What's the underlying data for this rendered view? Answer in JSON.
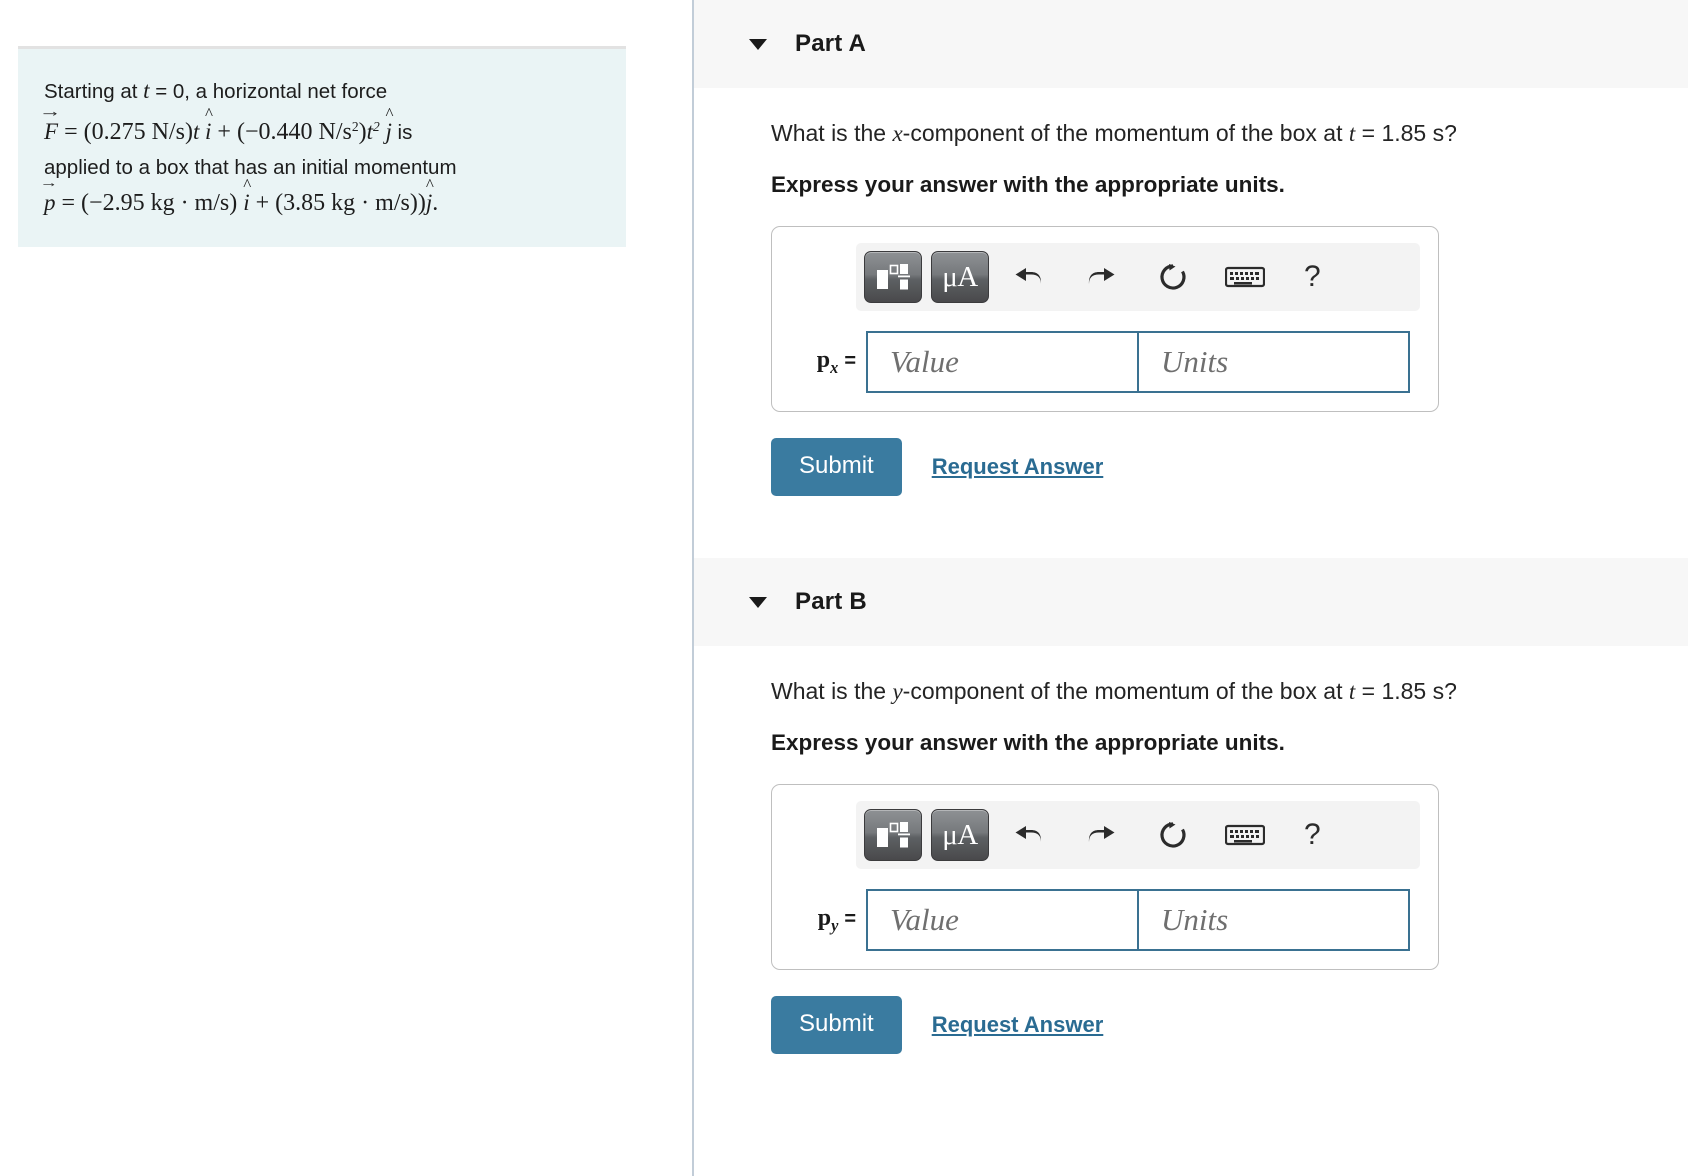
{
  "problem": {
    "line1_pre": "Starting at ",
    "line1_var": "t",
    "line1_post": " = 0, a horizontal net force",
    "force_symbol": "F",
    "force_coeff1": "0.275 N/s",
    "force_coeff2": "−0.440 N/s",
    "force_tail": "is",
    "line3": "applied to a box that has an initial momentum",
    "momentum_symbol": "p",
    "momentum_x": "−2.95 kg · m/s",
    "momentum_y": "3.85 kg · m/s"
  },
  "parts": [
    {
      "id": "a",
      "title": "Part A",
      "caret": "caret-down-icon",
      "question_pre": "What is the ",
      "question_var": "x",
      "question_mid": "-component of the momentum of the box at ",
      "question_time_var": "t",
      "question_post": " = 1.85 s?",
      "express": "Express your answer with the appropriate units.",
      "toolbar": {
        "template_button": "math-template-icon",
        "units_button": "μA",
        "units_button_name": "greek-units-icon",
        "undo": "undo-icon",
        "redo": "redo-icon",
        "reset": "reset-icon",
        "keyboard": "keyboard-icon",
        "help": "?"
      },
      "field_label_base": "p",
      "field_label_sub": "x",
      "field_label_eq": "=",
      "value_placeholder": "Value",
      "units_placeholder": "Units",
      "value_text": "",
      "units_text": "",
      "submit_label": "Submit",
      "request_label": "Request Answer"
    },
    {
      "id": "b",
      "title": "Part B",
      "caret": "caret-down-icon",
      "question_pre": "What is the ",
      "question_var": "y",
      "question_mid": "-component of the momentum of the box at ",
      "question_time_var": "t",
      "question_post": " = 1.85 s?",
      "express": "Express your answer with the appropriate units.",
      "toolbar": {
        "template_button": "math-template-icon",
        "units_button": "μA",
        "units_button_name": "greek-units-icon",
        "undo": "undo-icon",
        "redo": "redo-icon",
        "reset": "reset-icon",
        "keyboard": "keyboard-icon",
        "help": "?"
      },
      "field_label_base": "p",
      "field_label_sub": "y",
      "field_label_eq": "=",
      "value_placeholder": "Value",
      "units_placeholder": "Units",
      "value_text": "",
      "units_text": "",
      "submit_label": "Submit",
      "request_label": "Request Answer"
    }
  ],
  "colors": {
    "statement_bg": "#eaf4f5",
    "header_bg": "#f7f7f7",
    "accent": "#3a7ba0",
    "field_border": "#3a7191",
    "link": "#2a6b92"
  }
}
